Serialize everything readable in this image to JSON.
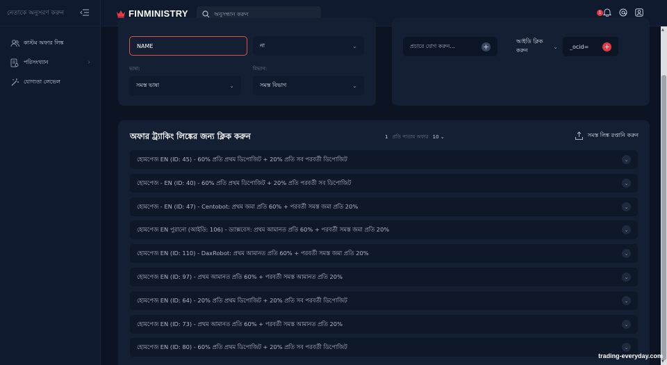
{
  "sidebar": {
    "header_text": "নেতাকে অনুসরণ করুন",
    "items": [
      {
        "label": "কাস্টম অফার লিঙ্ক"
      },
      {
        "label": "পরিসংখ্যান"
      },
      {
        "label": "যোগ্যতা লেভেল"
      }
    ]
  },
  "header": {
    "brand": "FINMINISTRY",
    "search_placeholder": "অনুসন্ধান করুন",
    "notification_count": "1"
  },
  "filters": {
    "name_value": "NAME",
    "type_value": "না",
    "language_label": "ভাষা:",
    "language_value": "সমস্ত ভাষা",
    "department_label": "বিভাগ:",
    "department_value": "সমস্ত বিভাগ"
  },
  "link_builder": {
    "promo_placeholder": "প্রচারে যোগ করুন...",
    "add_click_label": "আইডি ক্লিক করুন",
    "ocid_value": "_ocid="
  },
  "offers": {
    "title": "অফার ট্র্যাকিং লিঙ্কের জন্য ক্লিক করুন",
    "page_number": "1",
    "per_page_label": "প্রতি পাতায় অফার",
    "per_page_value": "10",
    "export_label": "সমস্ত লিঙ্ক রপ্তানি করুন",
    "rows": [
      "হোমপেজ EN (ID: 45) - 60% প্রতি প্রথম ডিপোজিট + 20% প্রতি সব পরবর্তী ডিপোজিট",
      "হোমপেজ - EN (ID: 40) - 60% প্রতি প্রথম ডিপোজিট + 20% প্রতি পরবর্তী সব ডিপোজিট",
      "হোমপেজ - EN (ID: 47) - Centobot: প্রথম জমা প্রতি 60% + পরবর্তী সমস্ত জমা প্রতি 20%",
      "হোমপেজ EN পুরানো (আইডি: 106) - ড্যাক্সবেস: প্রথম আমানত প্রতি 60% + পরবর্তী সমস্ত জমা প্রতি 20%",
      "হোমপেজ EN (ID: 110) - DaxRobot: প্রথম আমানত প্রতি 60% + পরবর্তী সমস্ত জমা প্রতি 20%",
      "হোমপেজ EN (ID: 97) - প্রথম আমানত প্রতি 60% + পরবর্তী সমস্ত আমানত প্রতি 20%",
      "হোমপেজ EN (ID: 64) - 20% প্রতি প্রথম ডিপোজিট + 20% প্রতি সব পরবর্তী ডিপোজিট",
      "হোমপেজ EN (ID: 73) - প্রথম আমানত প্রতি 60% + পরবর্তী সমস্ত আমানত প্রতি 20%",
      "হোমপেজ EN (ID: 80) - 60% প্রতি প্রথম ডিপোজিট + 20% প্রতি সব পরবর্তী ডিপোজিট"
    ]
  },
  "watermark": "trading-everyday.com",
  "colors": {
    "background": "#0c1424",
    "card": "#141f33",
    "accent_red": "#e53945",
    "brand_red": "#d9534f"
  }
}
